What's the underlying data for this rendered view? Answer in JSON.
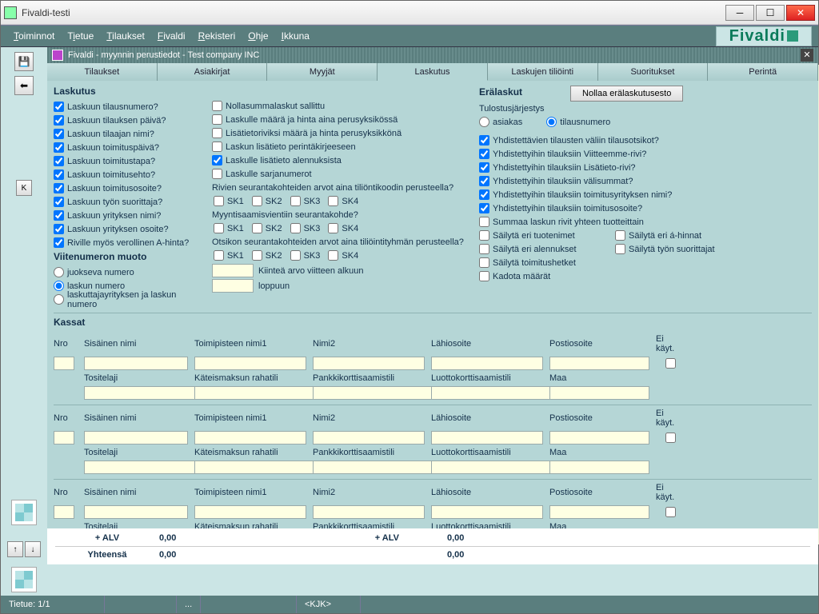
{
  "window": {
    "title": "Fivaldi-testi"
  },
  "brand": "Fivaldi",
  "menu": {
    "toiminnot": "Toiminnot",
    "tietue": "Tietue",
    "tilaukset": "Tilaukset",
    "fivaldi": "Fivaldi",
    "rekisteri": "Rekisteri",
    "ohje": "Ohje",
    "ikkuna": "Ikkuna"
  },
  "inner": {
    "title": "Fivaldi - myynnin perustiedot - Test company INC"
  },
  "tabs": {
    "t1": "Tilaukset",
    "t2": "Asiakirjat",
    "t3": "Myyjät",
    "t4": "Laskutus",
    "t5": "Laskujen tiliöinti",
    "t6": "Suoritukset",
    "t7": "Perintä"
  },
  "sec": {
    "laskutus": "Laskutus",
    "eralaskut": "Erälaskut",
    "btn_nollaa": "Nollaa erälaskutusesto",
    "tulostus": "Tulostusjärjestys",
    "viitenum": "Viitenumeron muoto",
    "kassat": "Kassat"
  },
  "left_checks": [
    "Laskuun tilausnumero?",
    "Laskuun tilauksen päivä?",
    "Laskuun tilaajan nimi?",
    "Laskuun toimituspäivä?",
    "Laskuun toimitustapa?",
    "Laskuun toimitusehto?",
    "Laskuun toimitusosoite?",
    "Laskuun työn suorittaja?",
    "Laskuun yrityksen nimi?",
    "Laskuun yrityksen osoite?",
    "Riville myös verollinen A-hinta?"
  ],
  "mid_checks": [
    "Nollasummalaskut sallittu",
    "Laskulle määrä ja hinta aina perusyksikössä",
    "Lisätietoriviksi määrä ja hinta perusyksikkönä",
    "Laskun lisätieto perintäkirjeeseen",
    "Laskulle lisätieto alennuksista",
    "Laskulle sarjanumerot"
  ],
  "mid_q1": "Rivien seurantakohteiden arvot aina tiliöntikoodin perusteella?",
  "mid_q2": "Myyntisaamisvientiin seurantakohde?",
  "mid_q3": "Otsikon seurantakohteiden arvot aina tiliöintityhmän  perusteella?",
  "sk": {
    "sk1": "SK1",
    "sk2": "SK2",
    "sk3": "SK3",
    "sk4": "SK4"
  },
  "radios_tul": {
    "asiakas": "asiakas",
    "tilaus": "tilausnumero"
  },
  "right_checks": [
    "Yhdistettävien tilausten väliin tilausotsikot?",
    "Yhdistettyihin tilauksiin Viitteemme-rivi?",
    "Yhdistettyihin tilauksiin Lisätieto-rivi?",
    "Yhdistettyihin tilauksiin välisummat?",
    "Yhdistettyihin tilauksiin toimitusyrityksen nimi?",
    "Yhdistettyihin tilauksiin toimitusosoite?"
  ],
  "right_checks2": [
    "Summaa laskun rivit yhteen tuotteittain",
    "Säilytä eri tuotenimet",
    "Säilytä eri alennukset",
    "Säilytä toimitushetket",
    "Kadota määrät"
  ],
  "right_checks3": [
    "Säilytä eri á-hinnat",
    "Säilytä työn suorittajat"
  ],
  "viite_radios": [
    "juokseva numero",
    "laskun numero",
    "laskuttajayrityksen ja laskun numero"
  ],
  "viite_labels": {
    "a": "Kiinteä arvo viitteen alkuun",
    "b": "loppuun"
  },
  "kassat_hdr": {
    "nro": "Nro",
    "sis": "Sisäinen nimi",
    "tp": "Toimipisteen nimi1",
    "n2": "Nimi2",
    "lah": "Lähiosoite",
    "pos": "Postiosoite",
    "ei": "Ei käyt.",
    "tos": "Tositelaji",
    "kat": "Käteismaksun rahatili",
    "pan": "Pankkikorttisaamistili",
    "luo": "Luottokorttisaamistili",
    "maa": "Maa"
  },
  "totals": {
    "alv": "+ ALV",
    "yht": "Yhteensä",
    "z": "0,00"
  },
  "status": {
    "tietue": "Tietue: 1/1",
    "dots": "...",
    "kjk": "<KJK>"
  },
  "k": "K"
}
